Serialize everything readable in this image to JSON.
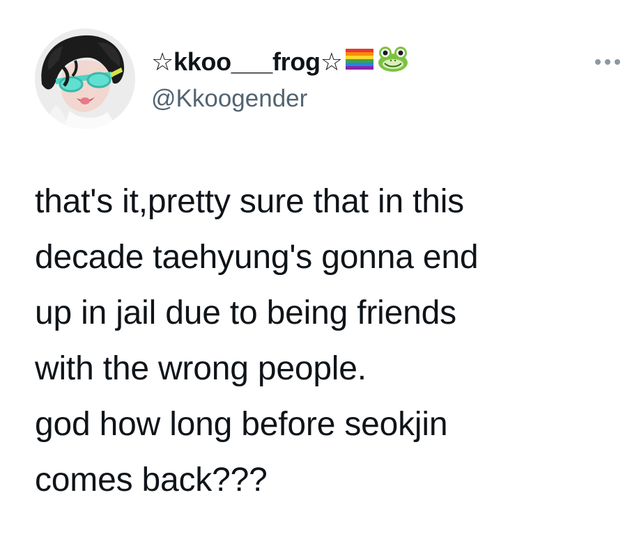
{
  "tweet": {
    "display_name": "☆kkoo___frog☆",
    "name_emojis": [
      "rainbow-flag-icon",
      "frog-face-icon"
    ],
    "handle": "@Kkoogender",
    "text": "that's it,pretty sure that in this\ndecade taehyung's gonna end\nup in jail due to being friends\nwith the wrong people.\ngod how long before seokjin\ncomes back???",
    "more_icon": "more-horizontal-icon",
    "colors": {
      "text": "#0f1419",
      "secondary": "#536471",
      "background": "#ffffff"
    }
  }
}
